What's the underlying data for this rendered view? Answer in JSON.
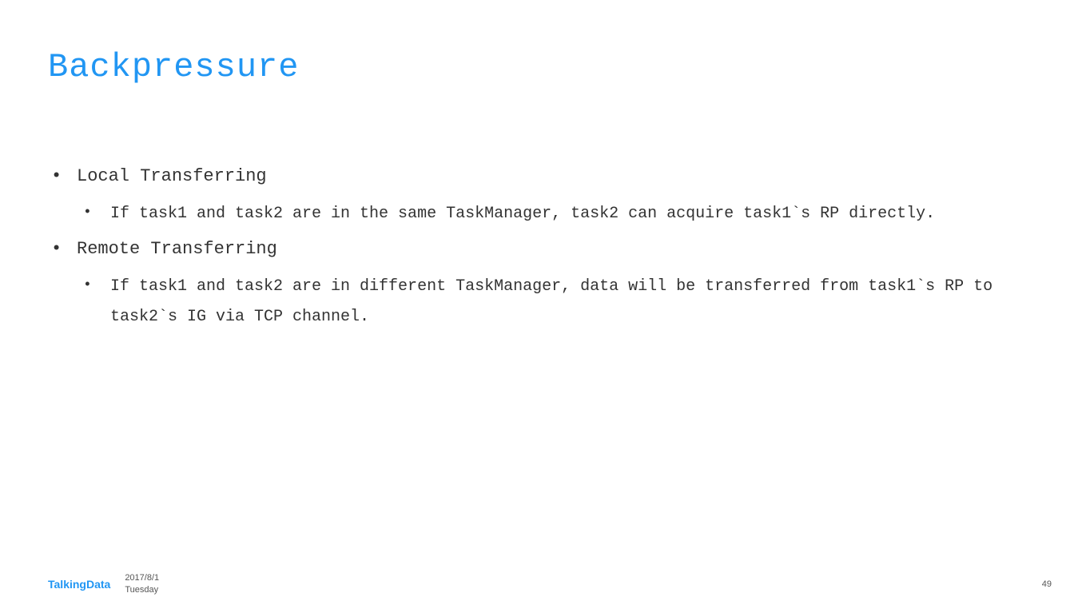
{
  "title": "Backpressure",
  "bullets": [
    {
      "heading": "Local Transferring",
      "sub": "If task1 and task2 are in the same TaskManager, task2 can acquire task1`s RP directly."
    },
    {
      "heading": "Remote Transferring",
      "sub": "If task1 and task2 are in different TaskManager, data will be transferred from task1`s RP to task2`s IG via TCP channel."
    }
  ],
  "footer": {
    "logo": "TalkingData",
    "date": "2017/8/1",
    "day": "Tuesday"
  },
  "page_number": "49"
}
